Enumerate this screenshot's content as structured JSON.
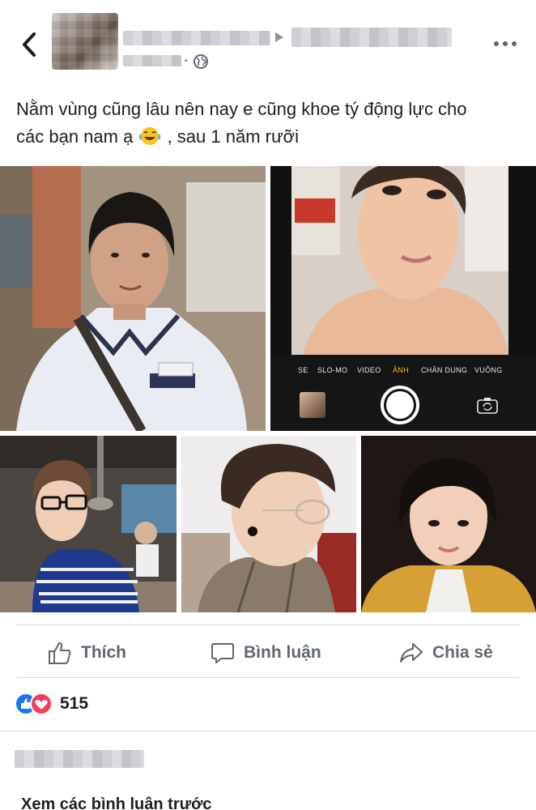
{
  "header": {
    "back_icon": "chevron-left-icon",
    "author_name": "",
    "privacy_icon": "globe-icon",
    "more_icon": "ellipsis-icon"
  },
  "post": {
    "text_line1": "Nằm vùng cũng lâu nên nay e cũng khoe tý động lực cho",
    "text_line2_a": "các bạn nam ạ",
    "text_line2_b": " , sau 1 năm rưỡi",
    "emoji": "tears-of-joy-emoji"
  },
  "camera": {
    "modes": [
      "SE",
      "SLO-MO",
      "VIDEO",
      "ẢNH",
      "CHÂN DUNG",
      "VUÔNG"
    ],
    "active_mode": "ẢNH"
  },
  "actions": {
    "like_label": "Thích",
    "comment_label": "Bình luận",
    "share_label": "Chia sẻ"
  },
  "reactions": {
    "count": "515",
    "types": [
      "like",
      "love"
    ]
  },
  "comments": {
    "view_more_label": "Xem các bình luận trước"
  },
  "colors": {
    "text": "#1c1e21",
    "secondary": "#606770",
    "like_blue": "#1877f2",
    "love_red": "#f33e58",
    "camera_active": "#f2c200"
  }
}
